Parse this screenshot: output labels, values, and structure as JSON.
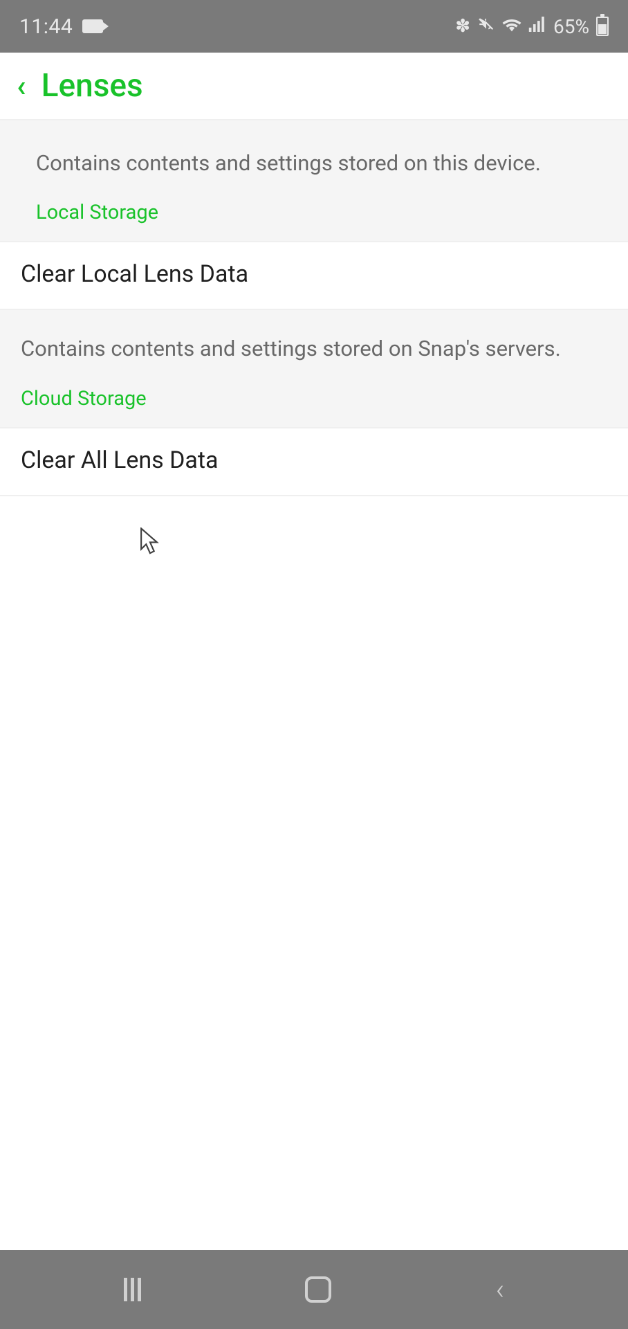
{
  "status_bar": {
    "time": "11:44",
    "battery_percent": "65%"
  },
  "header": {
    "title": "Lenses"
  },
  "sections": [
    {
      "description": "Contains contents and settings stored on this device.",
      "label": "Local Storage",
      "action": "Clear Local Lens Data"
    },
    {
      "description": "Contains contents and settings stored on Snap's servers.",
      "label": "Cloud Storage",
      "action": "Clear All Lens Data"
    }
  ]
}
